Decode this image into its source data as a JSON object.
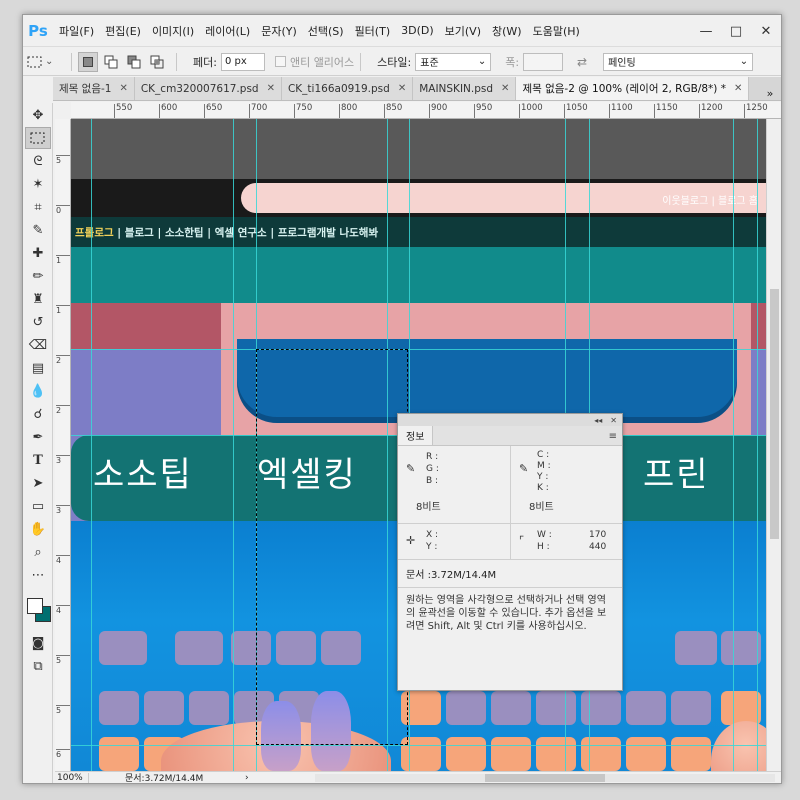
{
  "app": {
    "logo": "Ps",
    "menu": [
      "파일(F)",
      "편집(E)",
      "이미지(I)",
      "레이어(L)",
      "문자(Y)",
      "선택(S)",
      "필터(T)",
      "3D(D)",
      "보기(V)",
      "창(W)",
      "도움말(H)"
    ],
    "window_controls": {
      "minimize": "—",
      "restore": "□",
      "close": "✕"
    }
  },
  "options_bar": {
    "feather_label": "페더:",
    "feather_value": "0 px",
    "antialias_label": "앤티 앨리어스",
    "style_label": "스타일:",
    "style_value": "표준",
    "width_label": "폭:",
    "refine_label": "페인팅"
  },
  "tabs": [
    {
      "label": "제목 없음-1",
      "close": "✕",
      "active": false
    },
    {
      "label": "CK_cm320007617.psd",
      "close": "✕",
      "active": false
    },
    {
      "label": "CK_ti166a0919.psd",
      "close": "✕",
      "active": false
    },
    {
      "label": "MAINSKIN.psd",
      "close": "✕",
      "active": false
    },
    {
      "label": "제목 없음-2 @ 100% (레이어 2, RGB/8*) *",
      "close": "✕",
      "active": true
    }
  ],
  "tabs_more": "»",
  "ruler_h": [
    "550",
    "600",
    "650",
    "700",
    "750",
    "800",
    "850",
    "900",
    "950",
    "1000",
    "1050",
    "1100",
    "1150",
    "1200",
    "1250"
  ],
  "ruler_v": [
    "5",
    "0",
    "1",
    "1",
    "2",
    "2",
    "3",
    "3",
    "4",
    "4",
    "5",
    "5",
    "6"
  ],
  "canvas": {
    "top_right_text": "이웃블로그  |  블로그 홈",
    "nav_items": [
      "프롤로그",
      "블로그",
      "소소한팁",
      "엑셀 연구소",
      "프로그램개발 나도해봐"
    ],
    "nav_separator": "|",
    "big_labels": [
      "소소팁",
      "엑셀킹",
      "프린"
    ]
  },
  "info_panel": {
    "collapse": "◂◂",
    "close": "✕",
    "tab": "정보",
    "menu_icon": "≡",
    "rgb_labels": [
      "R :",
      "G :",
      "B :"
    ],
    "cmyk_labels": [
      "C :",
      "M :",
      "Y :",
      "K :"
    ],
    "bits_left": "8비트",
    "bits_right": "8비트",
    "xy_labels": [
      "X :",
      "Y :"
    ],
    "wh_labels": [
      "W :",
      "H :"
    ],
    "w_value": "170",
    "h_value": "440",
    "doc_label": "문서 :3.72M/14.4M",
    "help_text": "원하는 영역을 사각형으로 선택하거나 선택 영역의 윤곽선을 이동할 수 있습니다. 추가 옵션을 보려면 Shift, Alt 및 Ctrl 키를 사용하십시오."
  },
  "status": {
    "zoom": "100%",
    "doc": "문서:3.72M/14.4M",
    "arrow": "›"
  },
  "colors": {
    "foreground": "#ffffff",
    "background": "#006f70",
    "guide": "#38d7d7"
  }
}
